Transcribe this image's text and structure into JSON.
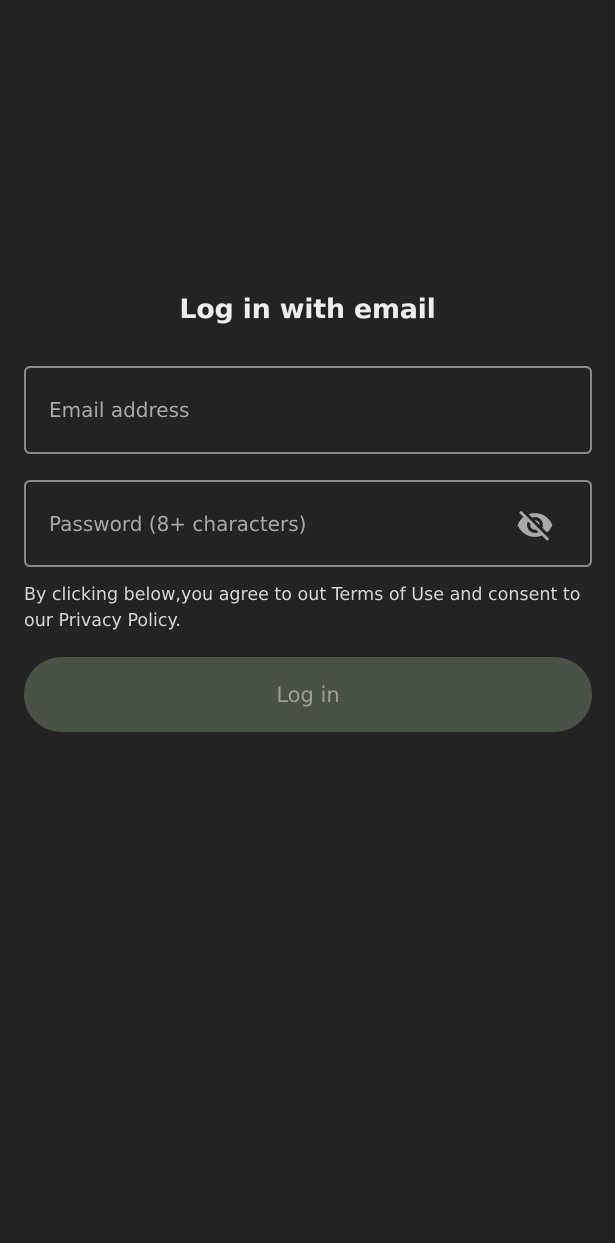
{
  "page": {
    "title": "Log in with email"
  },
  "form": {
    "email": {
      "value": "",
      "placeholder": "Email address"
    },
    "password": {
      "value": "",
      "placeholder": "Password (8+ characters)",
      "visibility_icon": "eye-off-icon"
    },
    "consent_text": "By clicking below,you agree to out Terms of Use and consent to our Privacy Policy.",
    "login_label": "Log in"
  },
  "colors": {
    "background": "#232323",
    "field_border": "#8a8a8a",
    "button_background": "#4a5147",
    "button_text": "#9aa097",
    "text_primary": "#ededed",
    "text_muted": "#a9a9a9"
  }
}
